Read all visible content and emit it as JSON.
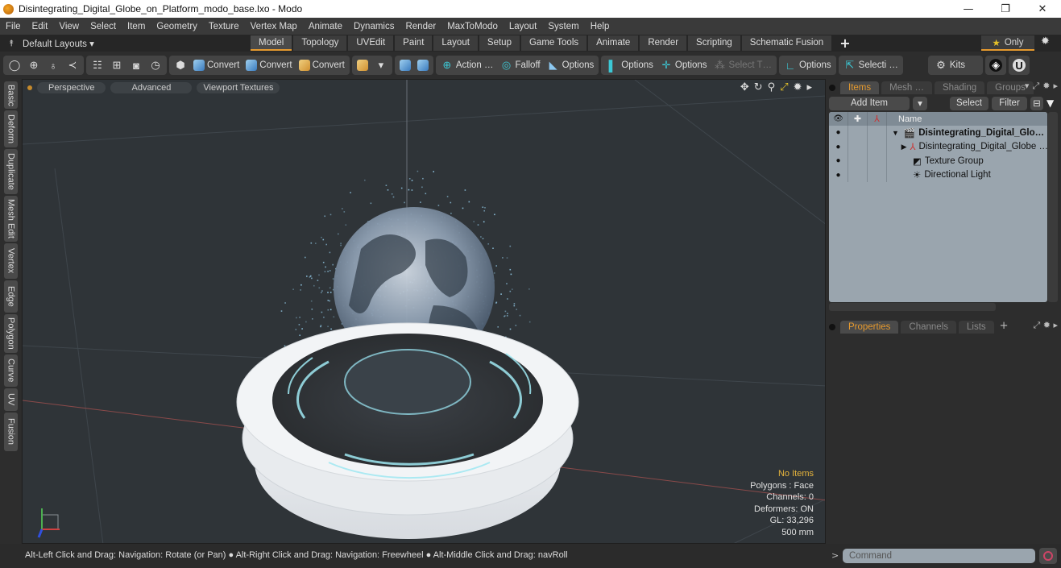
{
  "window": {
    "title": "Disintegrating_Digital_Globe_on_Platform_modo_base.lxo - Modo",
    "controls": {
      "minimize": "—",
      "restore": "❐",
      "close": "✕"
    }
  },
  "menu": [
    "File",
    "Edit",
    "View",
    "Select",
    "Item",
    "Geometry",
    "Texture",
    "Vertex Map",
    "Animate",
    "Dynamics",
    "Render",
    "MaxToModo",
    "Layout",
    "System",
    "Help"
  ],
  "layouts": {
    "selector": "Default Layouts ▾",
    "tabs": [
      "Model",
      "Topology",
      "UVEdit",
      "Paint",
      "Layout",
      "Setup",
      "Game Tools",
      "Animate",
      "Render",
      "Scripting",
      "Schematic Fusion"
    ],
    "active_tab": "Model",
    "add": "+",
    "only_label": "Only"
  },
  "toolbar": {
    "convert1": "Convert",
    "convert2": "Convert",
    "convert3": "Convert",
    "action": "Action …",
    "falloff": "Falloff",
    "options1": "Options",
    "options2": "Options",
    "options3": "Options",
    "select_t": "Select T…",
    "options4": "Options",
    "selecti": "Selecti …",
    "kits": "Kits"
  },
  "side_tabs": [
    "Basic",
    "Deform",
    "Duplicate",
    "Mesh Edit",
    "Vertex",
    "Edge",
    "Polygon",
    "Curve",
    "UV",
    "Fusion"
  ],
  "viewport": {
    "view": "Perspective",
    "shading": "Advanced",
    "textures": "Viewport Textures",
    "stats": {
      "selection": "No Items",
      "polygons": "Polygons : Face",
      "channels": "Channels: 0",
      "deformers": "Deformers: ON",
      "gl": "GL: 33,296",
      "scale": "500 mm"
    }
  },
  "status": "Alt-Left Click and Drag: Navigation: Rotate (or Pan) ● Alt-Right Click and Drag: Navigation: Freewheel ● Alt-Middle Click and Drag: navRoll",
  "items_panel": {
    "tabs": [
      "Items",
      "Mesh …",
      "Shading",
      "Groups"
    ],
    "active_tab": "Items",
    "add_item": "Add Item",
    "select": "Select",
    "filter": "Filter",
    "name_header": "Name",
    "rows": [
      {
        "name": "Disintegrating_Digital_Glo…",
        "icon": "scene-icon",
        "bold": true
      },
      {
        "name": "Disintegrating_Digital_Globe …",
        "icon": "mesh-icon"
      },
      {
        "name": "Texture Group",
        "icon": "texture-group-icon"
      },
      {
        "name": "Directional Light",
        "icon": "light-icon"
      }
    ]
  },
  "properties_panel": {
    "tabs": [
      "Properties",
      "Channels",
      "Lists"
    ],
    "active_tab": "Properties",
    "add": "+"
  },
  "command": {
    "placeholder": "Command",
    "prompt": ">"
  }
}
